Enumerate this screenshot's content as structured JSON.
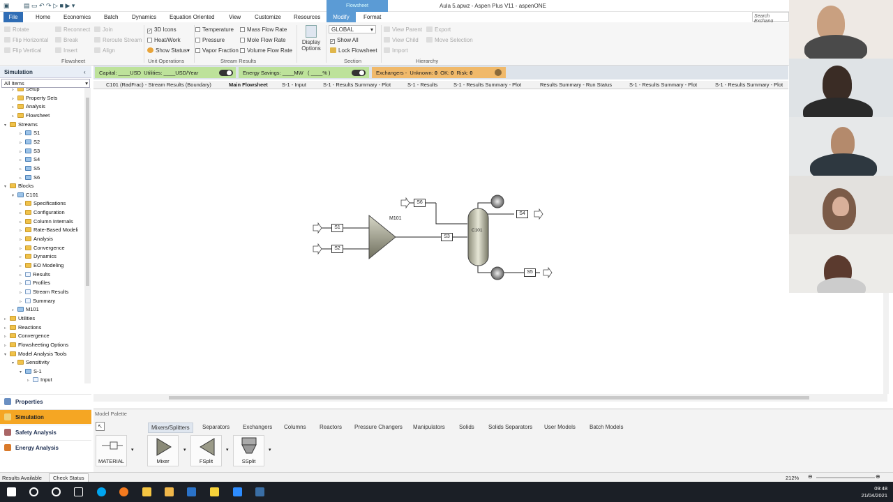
{
  "window": {
    "title": "Aula 5.apwz - Aspen Plus V11 - aspenONE",
    "context_tab": "Flowsheet"
  },
  "menu": {
    "file": "File",
    "items": [
      "Home",
      "Economics",
      "Batch",
      "Dynamics",
      "Equation Oriented",
      "View",
      "Customize",
      "Resources",
      "Modify",
      "Format"
    ],
    "search_placeholder": "Search Exchang"
  },
  "ribbon": {
    "flowsheet": {
      "rotate": "Rotate",
      "reconnect": "Reconnect",
      "join": "Join",
      "flip_horizontal": "Flip Horizontal",
      "break": "Break",
      "reroute": "Reroute Stream",
      "flip_vertical": "Flip Vertical",
      "insert": "Insert",
      "align": "Align",
      "group": "Flowsheet"
    },
    "unit_ops": {
      "icons3d": "3D Icons",
      "heatwork": "Heat/Work",
      "show_status": "Show Status",
      "group": "Unit Operations"
    },
    "stream_results": {
      "temperature": "Temperature",
      "pressure": "Pressure",
      "vapor_fraction": "Vapor Fraction",
      "mass_flow": "Mass Flow Rate",
      "mole_flow": "Mole Flow Rate",
      "volume_flow": "Volume Flow Rate",
      "group": "Stream Results"
    },
    "display": {
      "label1": "Display",
      "label2": "Options"
    },
    "section": {
      "value": "GLOBAL",
      "show_all": "Show All",
      "lock": "Lock Flowsheet",
      "group": "Section"
    },
    "hierarchy": {
      "view_parent": "View Parent",
      "export": "Export",
      "view_child": "View Child",
      "move_selection": "Move Selection",
      "import": "Import",
      "group": "Hierarchy"
    }
  },
  "nav": {
    "header": "Simulation",
    "filter": "All Items",
    "tree": [
      "Setup",
      "Property Sets",
      "Analysis",
      "Flowsheet",
      "Streams",
      "S1",
      "S2",
      "S3",
      "S4",
      "S5",
      "S6",
      "Blocks",
      "C101",
      "Specifications",
      "Configuration",
      "Column Internals",
      "Rate-Based Modeli",
      "Analysis",
      "Convergence",
      "Dynamics",
      "EO Modeling",
      "Results",
      "Profiles",
      "Stream Results",
      "Summary",
      "M101",
      "Utilities",
      "Reactions",
      "Convergence",
      "Flowsheeting Options",
      "Model Analysis Tools",
      "Sensitivity",
      "S-1",
      "Input"
    ],
    "buttons": {
      "properties": "Properties",
      "simulation": "Simulation",
      "safety": "Safety Analysis",
      "energy": "Energy Analysis"
    }
  },
  "statusstrip": {
    "capital": "Capital: ____USD",
    "utilities": "Utilities: ____USD/Year",
    "energy": "Energy Savings: ____MW",
    "energy_pct": "( ____% )",
    "exchangers": "Exchangers -",
    "unknown_label": "Unknown:",
    "unknown": "0",
    "ok_label": "OK:",
    "ok": "0",
    "risk_label": "Risk:",
    "risk": "0"
  },
  "doc_tabs": [
    "C101 (RadFrac) - Stream Results (Boundary)",
    "Main Flowsheet",
    "S-1 - Input",
    "S-1 - Results Summary - Plot",
    "S-1 - Results",
    "S-1 - Results Summary - Plot",
    "Results Summary - Run Status",
    "S-1 - Results Summary - Plot",
    "S-1 - Results Summary - Plot"
  ],
  "flowsheet": {
    "streams": [
      "S1",
      "S2",
      "S3",
      "S4",
      "S5",
      "S6"
    ],
    "blocks": [
      "M101",
      "C101"
    ]
  },
  "palette": {
    "title": "Model Palette",
    "tabs": [
      "Mixers/Splitters",
      "Separators",
      "Exchangers",
      "Columns",
      "Reactors",
      "Pressure Changers",
      "Manipulators",
      "Solids",
      "Solids Separators",
      "User Models",
      "Batch Models"
    ],
    "items": [
      "MATERIAL",
      "Mixer",
      "FSplit",
      "SSplit"
    ]
  },
  "statusbar": {
    "results": "Results Available",
    "check": "Check Status",
    "zoom": "212%"
  },
  "taskbar": {
    "time": "09:48",
    "date": "21/04/2021"
  }
}
